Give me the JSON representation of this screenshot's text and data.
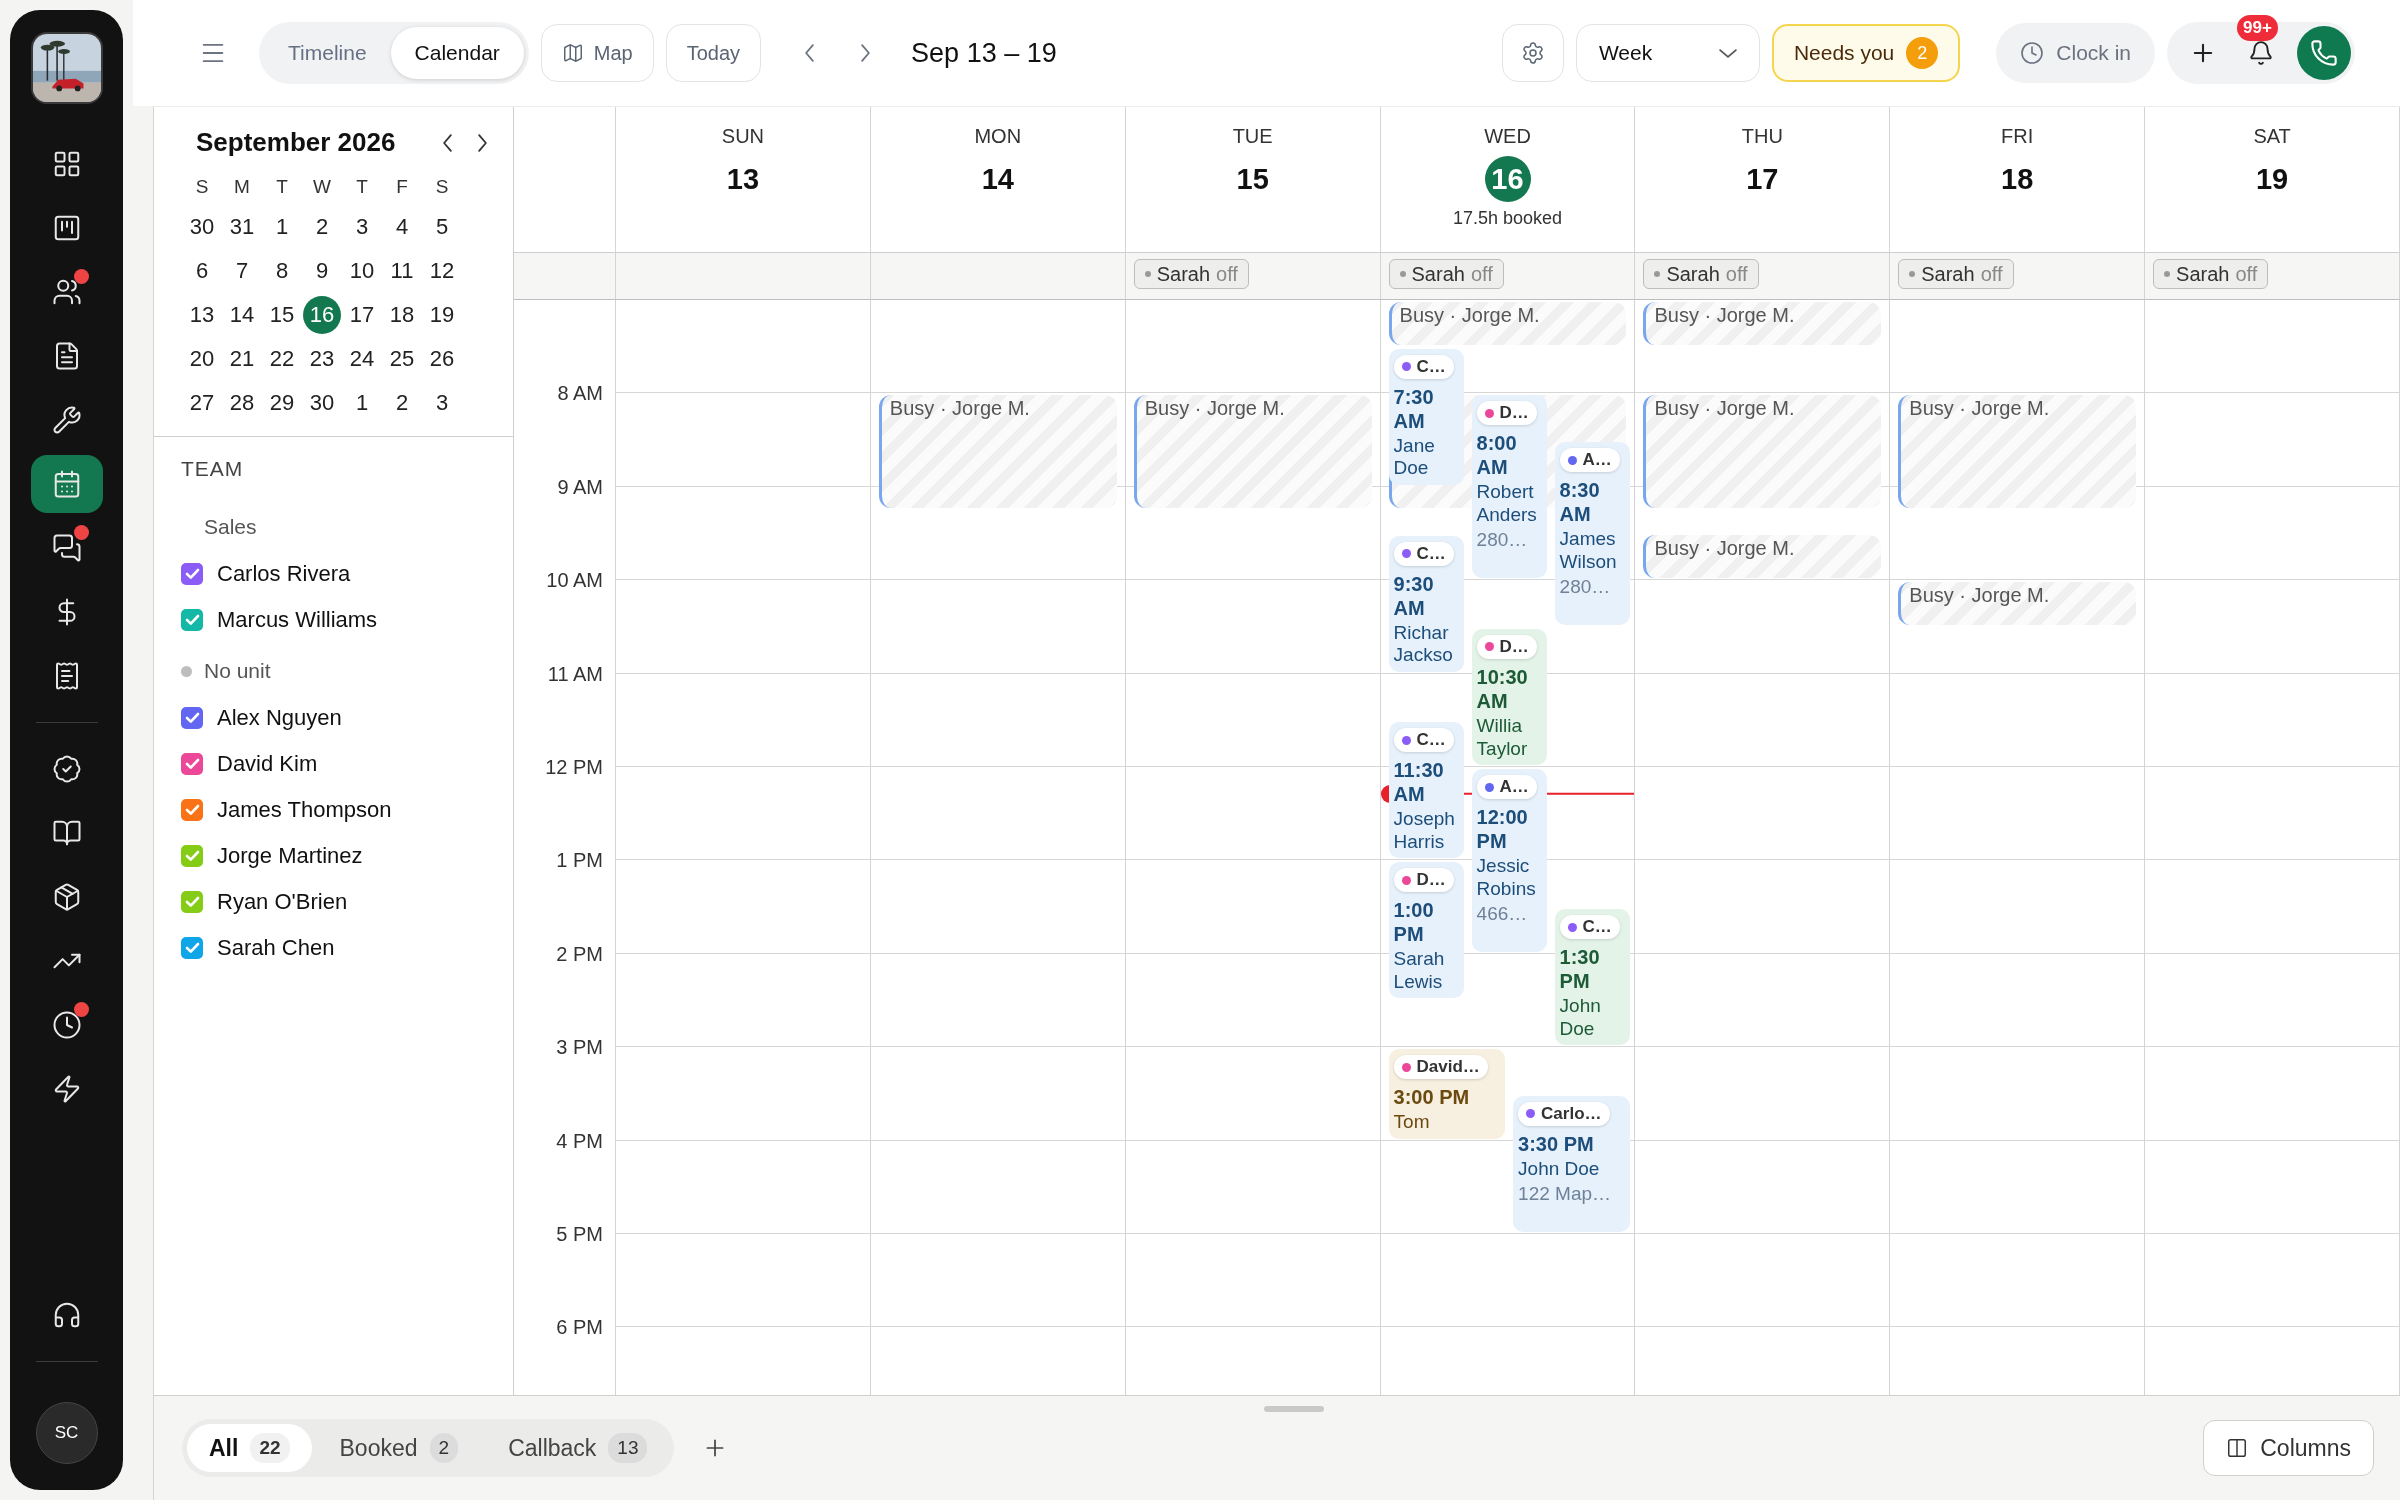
{
  "rail": {
    "main": [
      {
        "selected": false,
        "badge": false
      },
      {
        "selected": false,
        "badge": false
      },
      {
        "selected": false,
        "badge": true
      },
      {
        "selected": false,
        "badge": false
      },
      {
        "selected": false,
        "badge": false
      },
      {
        "selected": true,
        "badge": false
      },
      {
        "selected": false,
        "badge": true
      },
      {
        "selected": false,
        "badge": false
      },
      {
        "selected": false,
        "badge": false
      }
    ],
    "tools": [
      {
        "selected": false,
        "badge": false
      },
      {
        "selected": false,
        "badge": false
      },
      {
        "selected": false,
        "badge": false
      },
      {
        "selected": false,
        "badge": false
      },
      {
        "selected": false,
        "badge": true
      },
      {
        "selected": false,
        "badge": false
      }
    ],
    "support": [
      {
        "selected": false,
        "badge": false
      }
    ],
    "avatar": "SC"
  },
  "toolbar": {
    "views": [
      {
        "label": "Timeline",
        "selected": false
      },
      {
        "label": "Calendar",
        "selected": true
      }
    ],
    "map": "Map",
    "today": "Today",
    "range": "Sep 13 – 19",
    "period": "Week",
    "needs_you": {
      "label": "Needs you",
      "count": "2"
    },
    "clock_in": "Clock in",
    "notifications": "99+"
  },
  "sidebar": {
    "month": "September 2026",
    "weekdays": [
      "S",
      "M",
      "T",
      "W",
      "T",
      "F",
      "S"
    ],
    "days": [
      {
        "label": "30",
        "selected": false
      },
      {
        "label": "31",
        "selected": false
      },
      {
        "label": "1",
        "selected": false
      },
      {
        "label": "2",
        "selected": false
      },
      {
        "label": "3",
        "selected": false
      },
      {
        "label": "4",
        "selected": false
      },
      {
        "label": "5",
        "selected": false
      },
      {
        "label": "6",
        "selected": false
      },
      {
        "label": "7",
        "selected": false
      },
      {
        "label": "8",
        "selected": false
      },
      {
        "label": "9",
        "selected": false
      },
      {
        "label": "10",
        "selected": false
      },
      {
        "label": "11",
        "selected": false
      },
      {
        "label": "12",
        "selected": false
      },
      {
        "label": "13",
        "selected": false
      },
      {
        "label": "14",
        "selected": false
      },
      {
        "label": "15",
        "selected": false
      },
      {
        "label": "16",
        "selected": true
      },
      {
        "label": "17",
        "selected": false
      },
      {
        "label": "18",
        "selected": false
      },
      {
        "label": "19",
        "selected": false
      },
      {
        "label": "20",
        "selected": false
      },
      {
        "label": "21",
        "selected": false
      },
      {
        "label": "22",
        "selected": false
      },
      {
        "label": "23",
        "selected": false
      },
      {
        "label": "24",
        "selected": false
      },
      {
        "label": "25",
        "selected": false
      },
      {
        "label": "26",
        "selected": false
      },
      {
        "label": "27",
        "selected": false
      },
      {
        "label": "28",
        "selected": false
      },
      {
        "label": "29",
        "selected": false
      },
      {
        "label": "30",
        "selected": false
      },
      {
        "label": "1",
        "selected": false
      },
      {
        "label": "2",
        "selected": false
      },
      {
        "label": "3",
        "selected": false
      }
    ],
    "team_title": "TEAM",
    "groups": [
      {
        "name": "Sales",
        "dot": false,
        "members": [
          {
            "name": "Carlos Rivera",
            "color": "#8b5cf6",
            "checked": true
          },
          {
            "name": "Marcus Williams",
            "color": "#14b8a6",
            "checked": true
          }
        ]
      },
      {
        "name": "No unit",
        "dot": true,
        "members": [
          {
            "name": "Alex Nguyen",
            "color": "#6366f1",
            "checked": true
          },
          {
            "name": "David Kim",
            "color": "#ec4899",
            "checked": true
          },
          {
            "name": "James Thompson",
            "color": "#f97316",
            "checked": true
          },
          {
            "name": "Jorge Martinez",
            "color": "#84cc16",
            "checked": true
          },
          {
            "name": "Ryan O'Brien",
            "color": "#84cc16",
            "checked": true
          },
          {
            "name": "Sarah Chen",
            "color": "#0ea5e9",
            "checked": true
          }
        ]
      }
    ]
  },
  "calendar": {
    "hours": [
      "8 AM",
      "9 AM",
      "10 AM",
      "11 AM",
      "12 PM",
      "1 PM",
      "2 PM",
      "3 PM",
      "4 PM",
      "5 PM",
      "6 PM"
    ],
    "days": [
      {
        "weekday": "SUN",
        "date": "13",
        "selected": false
      },
      {
        "weekday": "MON",
        "date": "14",
        "selected": false,
        "slots": [
          {
            "busy": false
          },
          {
            "busy": true,
            "kind": "long",
            "label": "Busy · Jorge M."
          }
        ]
      },
      {
        "weekday": "TUE",
        "date": "15",
        "selected": false,
        "off": {
          "name": "Sarah",
          "status": "off"
        },
        "slots": [
          {
            "busy": false
          },
          {
            "busy": true,
            "kind": "long",
            "label": "Busy · Jorge M."
          }
        ]
      },
      {
        "weekday": "WED",
        "date": "16",
        "selected": true,
        "booked": "17.5h booked",
        "now": {
          "level": 0.451
        },
        "off": {
          "name": "Sarah",
          "status": "off"
        },
        "slots": [
          {
            "busy": true,
            "kind": "early",
            "label": "Busy · Jorge M."
          },
          {
            "busy": true,
            "kind": "long"
          }
        ],
        "events": [
          {
            "chip": {
              "label": "C…",
              "color": "#8b5cf6"
            },
            "time": "7:30 AM",
            "name": "Jane Doe",
            "color": "#e6f1fc",
            "kind": "standard"
          },
          {
            "chip": {
              "label": "D…",
              "color": "#ec4899"
            },
            "time": "8:00 AM",
            "name": "Robert Anders",
            "address": "280…",
            "color": "#e6f1fc",
            "kind": "long"
          },
          {
            "chip": {
              "label": "A…",
              "color": "#6366f1"
            },
            "time": "8:30 AM",
            "name": "James Wilson",
            "address": "280…",
            "color": "#e6f1fc",
            "kind": "long"
          },
          {
            "chip": {
              "label": "C…",
              "color": "#8b5cf6"
            },
            "time": "9:30 AM",
            "name": "Richar Jackso",
            "color": "#e6f1fc",
            "kind": "standard"
          },
          {
            "chip": {
              "label": "D…",
              "color": "#ec4899"
            },
            "time": "10:30 AM",
            "name": "Willia Taylor",
            "color": "#e4f3e8",
            "kind": "standard"
          },
          {
            "chip": {
              "label": "C…",
              "color": "#8b5cf6"
            },
            "time": "11:30 AM",
            "name": "Joseph Harris",
            "color": "#e6f1fc",
            "kind": "standard"
          },
          {
            "chip": {
              "label": "A…",
              "color": "#6366f1"
            },
            "time": "12:00 PM",
            "name": "Jessic Robins",
            "address": "466…",
            "color": "#e6f1fc",
            "kind": "long"
          },
          {
            "chip": {
              "label": "D…",
              "color": "#ec4899"
            },
            "time": "1:00 PM",
            "name": "Sarah Lewis",
            "color": "#e6f1fc",
            "kind": "standard"
          },
          {
            "chip": {
              "label": "C…",
              "color": "#8b5cf6"
            },
            "time": "1:30 PM",
            "name": "John Doe",
            "color": "#e4f3e8",
            "kind": "standard"
          },
          {
            "chip": {
              "label": "David…",
              "color": "#ec4899"
            },
            "time": "3:00 PM",
            "name": "Tom",
            "color": "#f7efdf",
            "kind": "short"
          },
          {
            "chip": {
              "label": "Carlo…",
              "color": "#8b5cf6"
            },
            "time": "3:30 PM",
            "name": "John Doe",
            "address": "122 Map…",
            "color": "#e6f1fc",
            "kind": "standard"
          }
        ]
      },
      {
        "weekday": "THU",
        "date": "17",
        "selected": false,
        "off": {
          "name": "Sarah",
          "status": "off"
        },
        "slots": [
          {
            "busy": true,
            "kind": "early",
            "label": "Busy · Jorge M."
          },
          {
            "busy": true,
            "kind": "long",
            "label": "Busy · Jorge M."
          },
          {
            "busy": true,
            "kind": "late",
            "label": "Busy · Jorge M."
          }
        ]
      },
      {
        "weekday": "FRI",
        "date": "18",
        "selected": false,
        "off": {
          "name": "Sarah",
          "status": "off"
        },
        "slots": [
          {
            "busy": false
          },
          {
            "busy": true,
            "kind": "long",
            "label": "Busy · Jorge M."
          },
          {
            "busy": false
          },
          {
            "busy": true,
            "kind": "early",
            "label": "Busy · Jorge M."
          }
        ]
      },
      {
        "weekday": "SAT",
        "date": "19",
        "selected": false,
        "off": {
          "name": "Sarah",
          "status": "off"
        }
      }
    ]
  },
  "footer": {
    "tabs": [
      {
        "label": "All",
        "count": "22",
        "selected": true
      },
      {
        "label": "Booked",
        "count": "2",
        "selected": false
      },
      {
        "label": "Callback",
        "count": "13",
        "selected": false
      }
    ],
    "columns": "Columns"
  }
}
